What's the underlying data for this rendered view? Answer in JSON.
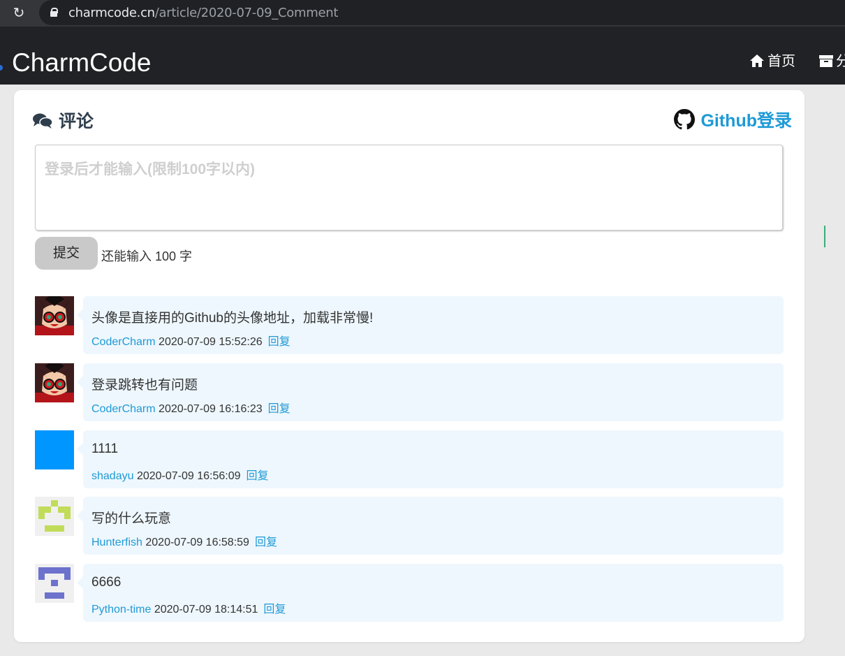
{
  "browser": {
    "url_host": "charmcode.cn",
    "url_path": "/article/2020-07-09_Comment"
  },
  "site": {
    "brand": "CharmCode",
    "nav": [
      {
        "label": "首页",
        "icon": "home-icon"
      },
      {
        "label": "分",
        "icon": "archive-icon"
      }
    ]
  },
  "comments_section": {
    "title": "评论",
    "title_icon": "comments-icon",
    "login_label": "Github登录",
    "login_icon": "github-icon",
    "textarea_placeholder": "登录后才能输入(限制100字以内)",
    "submit_label": "提交",
    "remaining_text": "还能输入 100 字",
    "reply_label": "回复",
    "comments": [
      {
        "text": "头像是直接用的Github的头像地址，加载非常慢!",
        "user": "CoderCharm",
        "time": "2020-07-09 15:52:26",
        "avatar": "anime-avatar"
      },
      {
        "text": "登录跳转也有问题",
        "user": "CoderCharm",
        "time": "2020-07-09 16:16:23",
        "avatar": "anime-avatar"
      },
      {
        "text": "1111",
        "user": "shadayu",
        "time": "2020-07-09 16:56:09",
        "avatar": "solid-blue-avatar"
      },
      {
        "text": "写的什么玩意",
        "user": "Hunterfish",
        "time": "2020-07-09 16:58:59",
        "avatar": "identicon-green"
      },
      {
        "text": "6666",
        "user": "Python-time",
        "time": "2020-07-09 18:14:51",
        "avatar": "identicon-purple"
      }
    ]
  },
  "colors": {
    "nav_bg": "#212226",
    "accent": "#1e9ad6",
    "bubble_bg": "#eef7fd",
    "identicon_green": "#c1dc58",
    "identicon_purple": "#6d72cc",
    "solid_blue": "#0096ff"
  }
}
